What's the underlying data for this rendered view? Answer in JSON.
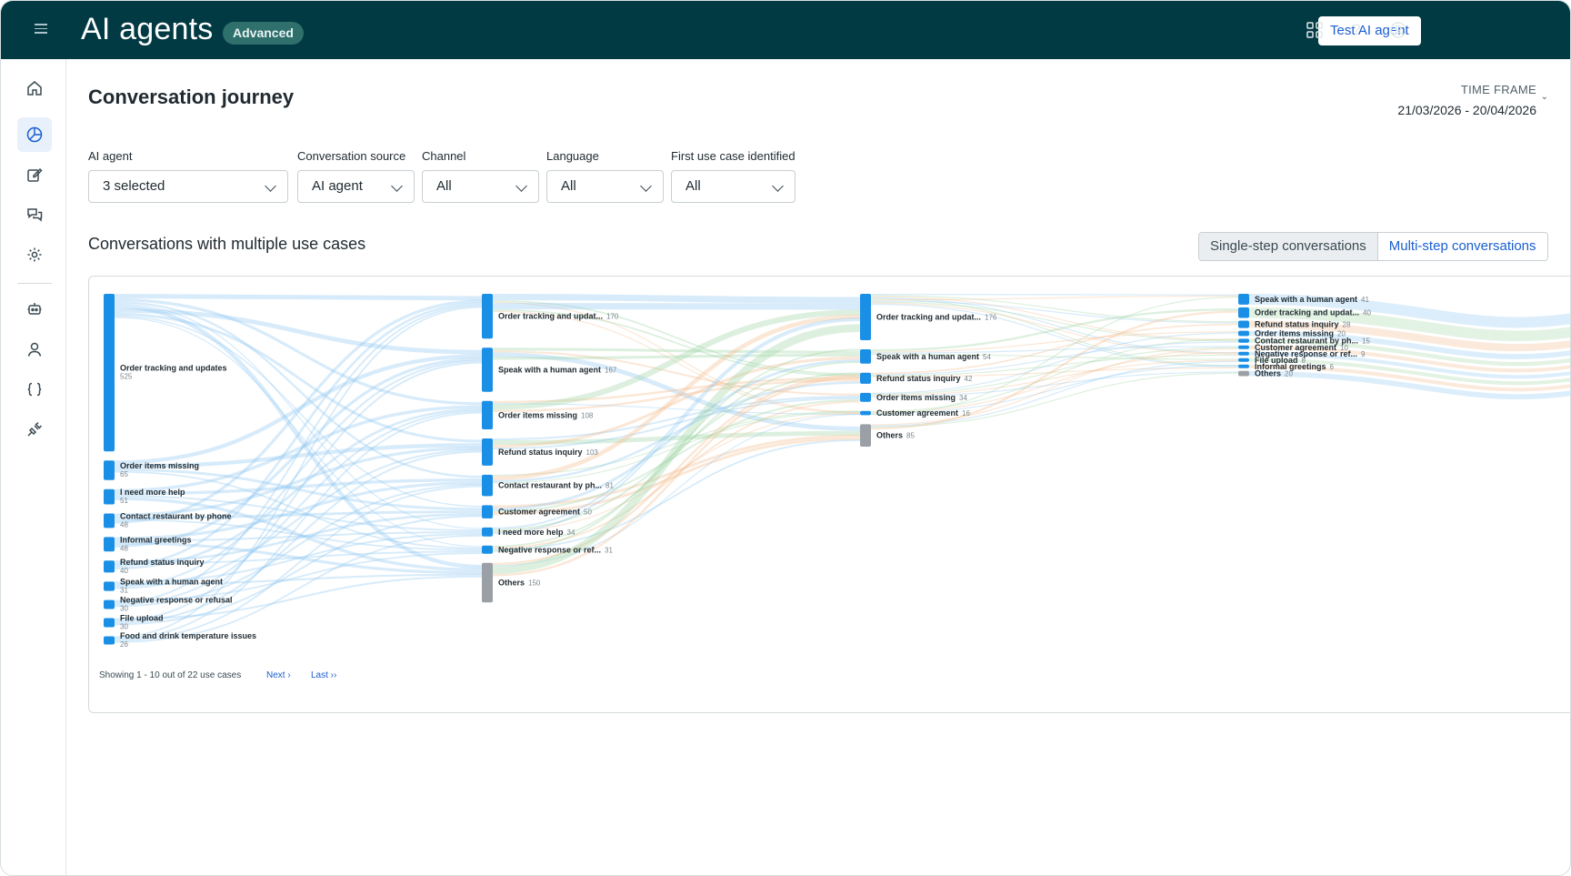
{
  "app": {
    "title": "AI agents",
    "badge": "Advanced",
    "test_button": "Test AI agent"
  },
  "header_icons": [
    "apps-grid-icon",
    "help-icon",
    "account-icon"
  ],
  "sidebar": {
    "items": [
      "home-icon",
      "analytics-icon",
      "edit-icon",
      "conversations-icon",
      "settings-icon",
      "bot-icon",
      "user-icon",
      "code-braces-icon",
      "plugin-icon"
    ],
    "active": "analytics-icon"
  },
  "page": {
    "title": "Conversation journey",
    "time_frame_label": "TIME FRAME",
    "time_frame_value": "21/03/2026 - 20/04/2026"
  },
  "filters": [
    {
      "label": "AI agent",
      "value": "3 selected"
    },
    {
      "label": "Conversation source",
      "value": "AI agent"
    },
    {
      "label": "Channel",
      "value": "All"
    },
    {
      "label": "Language",
      "value": "All"
    },
    {
      "label": "First use case identified",
      "value": "All"
    }
  ],
  "section": {
    "title": "Conversations with multiple use cases",
    "toggle": [
      "Single-step conversations",
      "Multi-step conversations"
    ],
    "active_toggle": 1
  },
  "pager": {
    "text": "Showing 1 - 10 out of 22 use cases",
    "next": "Next ›",
    "last": "Last ››"
  },
  "colors": {
    "node": "#1a8fe6",
    "others_node": "#9aa0a6",
    "header": "#023a44",
    "link_blue": "#8cc6f2",
    "link_green": "#9fd3a3",
    "link_orange": "#f3b98a"
  },
  "chart_data": {
    "type": "sankey",
    "columns": [
      {
        "step": 1,
        "nodes": [
          {
            "label": "Order tracking and updates",
            "value": 525
          },
          {
            "label": "Order items missing",
            "value": 65
          },
          {
            "label": "I need more help",
            "value": 51
          },
          {
            "label": "Contact restaurant by phone",
            "value": 48
          },
          {
            "label": "Informal greetings",
            "value": 48
          },
          {
            "label": "Refund status inquiry",
            "value": 40
          },
          {
            "label": "Speak with a human agent",
            "value": 31
          },
          {
            "label": "Negative response or refusal",
            "value": 30
          },
          {
            "label": "File upload",
            "value": 30
          },
          {
            "label": "Food and drink temperature issues",
            "value": 26
          }
        ]
      },
      {
        "step": 2,
        "nodes": [
          {
            "label": "Order tracking and updat...",
            "value": 170
          },
          {
            "label": "Speak with a human agent",
            "value": 167
          },
          {
            "label": "Order items missing",
            "value": 108
          },
          {
            "label": "Refund status inquiry",
            "value": 103
          },
          {
            "label": "Contact restaurant by ph...",
            "value": 81
          },
          {
            "label": "Customer agreement",
            "value": 50
          },
          {
            "label": "I need more help",
            "value": 34
          },
          {
            "label": "Negative response or ref...",
            "value": 31
          },
          {
            "label": "Others",
            "value": 150
          }
        ]
      },
      {
        "step": 3,
        "nodes": [
          {
            "label": "Order tracking and updat...",
            "value": 176
          },
          {
            "label": "Speak with a human agent",
            "value": 54
          },
          {
            "label": "Refund status inquiry",
            "value": 42
          },
          {
            "label": "Order items missing",
            "value": 34
          },
          {
            "label": "Customer agreement",
            "value": 16
          },
          {
            "label": "Others",
            "value": 85
          }
        ]
      },
      {
        "step": 4,
        "nodes": [
          {
            "label": "Speak with a human agent",
            "value": 41
          },
          {
            "label": "Order tracking and updat...",
            "value": 40
          },
          {
            "label": "Refund status inquiry",
            "value": 28
          },
          {
            "label": "Order items missing",
            "value": 20
          },
          {
            "label": "Contact restaurant by ph...",
            "value": 15
          },
          {
            "label": "Customer agreement",
            "value": 10
          },
          {
            "label": "Negative response or ref...",
            "value": 9
          },
          {
            "label": "File upload",
            "value": 8
          },
          {
            "label": "Informal greetings",
            "value": 6
          },
          {
            "label": "Others",
            "value": 20
          }
        ]
      }
    ]
  }
}
